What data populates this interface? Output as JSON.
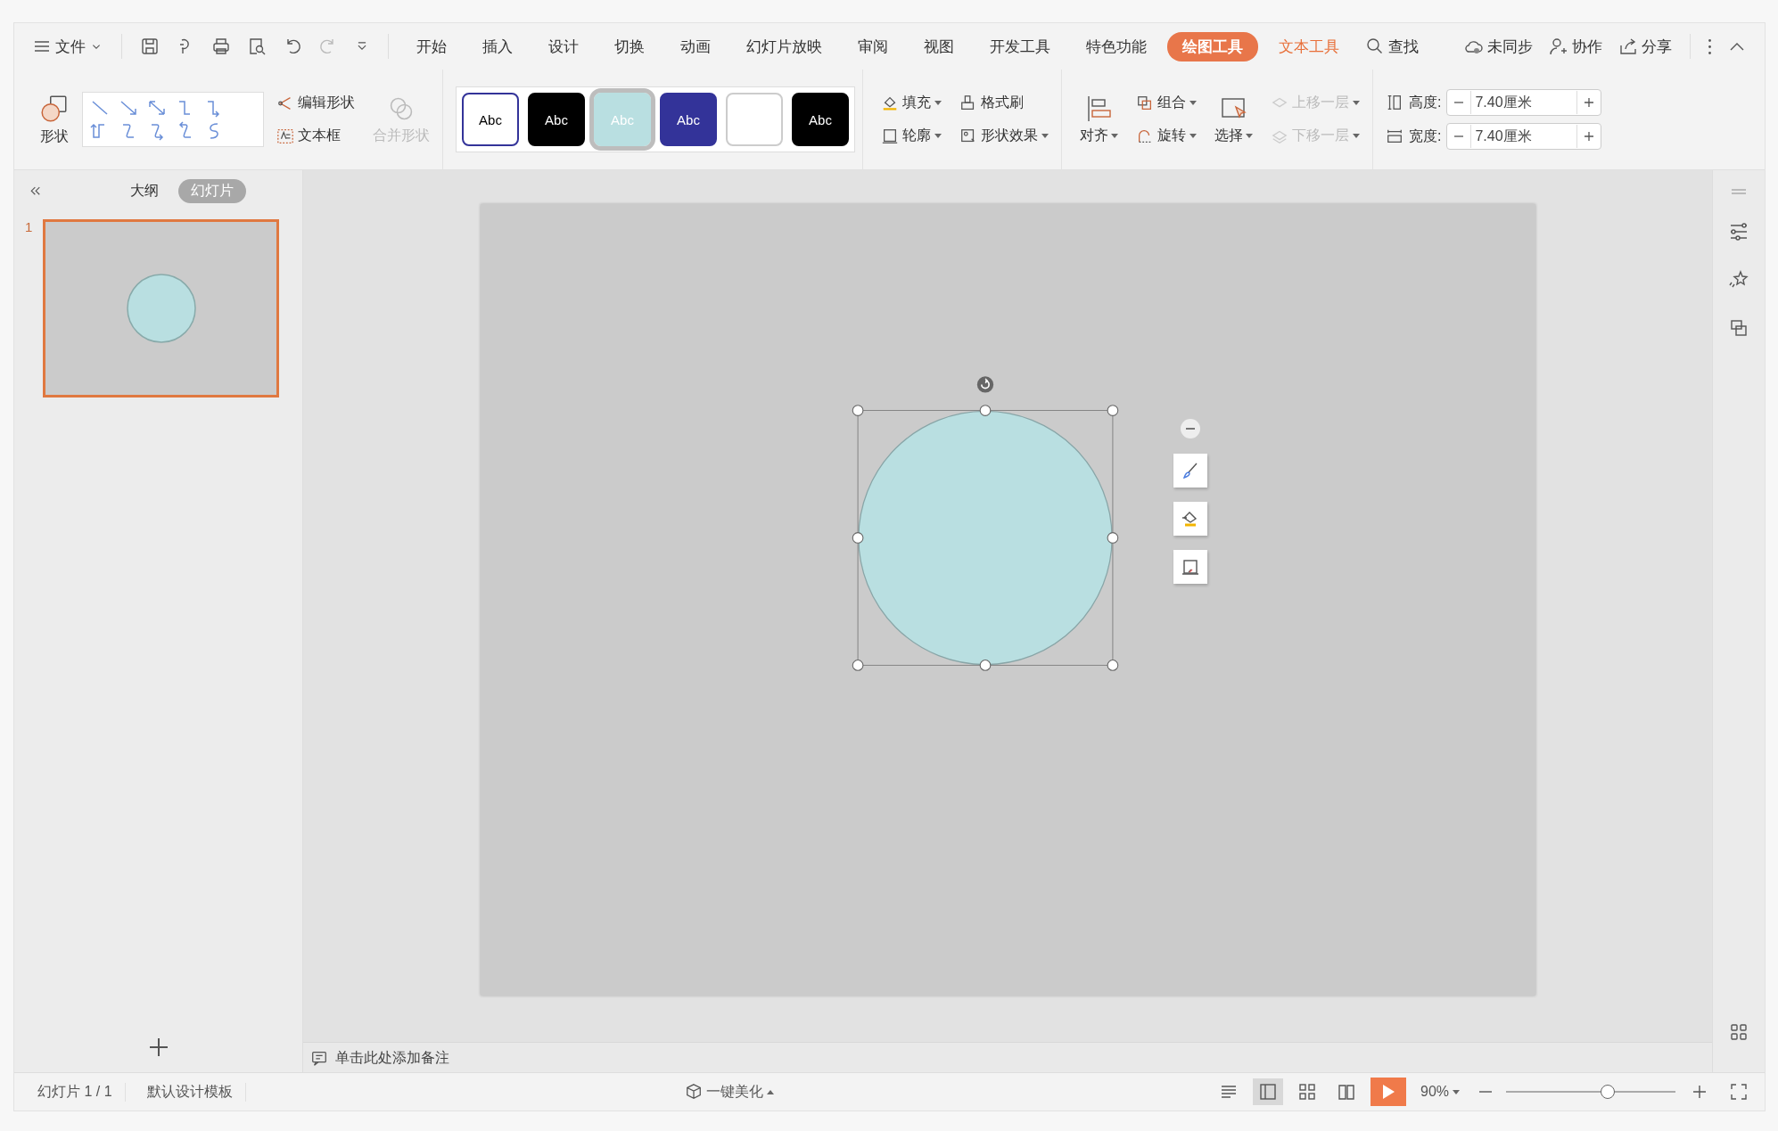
{
  "menu": {
    "label": "文件"
  },
  "tabs": [
    {
      "label": "开始",
      "selected": false,
      "kind": "normal"
    },
    {
      "label": "插入",
      "selected": false,
      "kind": "normal"
    },
    {
      "label": "设计",
      "selected": false,
      "kind": "normal"
    },
    {
      "label": "切换",
      "selected": false,
      "kind": "normal"
    },
    {
      "label": "动画",
      "selected": false,
      "kind": "normal"
    },
    {
      "label": "幻灯片放映",
      "selected": false,
      "kind": "normal"
    },
    {
      "label": "审阅",
      "selected": false,
      "kind": "normal"
    },
    {
      "label": "视图",
      "selected": false,
      "kind": "normal"
    },
    {
      "label": "开发工具",
      "selected": false,
      "kind": "normal"
    },
    {
      "label": "特色功能",
      "selected": false,
      "kind": "normal"
    },
    {
      "label": "绘图工具",
      "selected": true,
      "kind": "context"
    },
    {
      "label": "文本工具",
      "selected": false,
      "kind": "context"
    }
  ],
  "search": {
    "label": "查找"
  },
  "top_actions": [
    "未同步",
    "协作",
    "分享"
  ],
  "ribbon": {
    "shape_button": "形状",
    "edit_shape": "编辑形状",
    "text_box": "文本框",
    "merge_shapes": {
      "label": "合并形状",
      "disabled": true
    },
    "styles": [
      {
        "text": "Abc",
        "color": "#ffffff",
        "kind": "outlined",
        "selected": false
      },
      {
        "text": "Abc",
        "color": "#000000",
        "kind": "plain",
        "selected": false
      },
      {
        "text": "Abc",
        "color": "#b9dfe1",
        "kind": "plain",
        "selected": true
      },
      {
        "text": "Abc",
        "color": "#333399",
        "kind": "plain",
        "selected": false
      },
      {
        "color": "#ffffff",
        "kind": "plain",
        "selected": false
      },
      {
        "text": "Abc",
        "color": "#000000",
        "kind": "plain",
        "selected": false
      }
    ],
    "fill": "填充",
    "outline": "轮廓",
    "format_painter": "格式刷",
    "shape_effects": "形状效果",
    "align": "对齐",
    "group": "组合",
    "rotate": "旋转",
    "select": "选择",
    "bring_forward": {
      "label": "上移一层",
      "disabled": true
    },
    "send_backward": {
      "label": "下移一层",
      "disabled": true
    },
    "height": {
      "label": "高度:",
      "value": "7.40厘米"
    },
    "width": {
      "label": "宽度:",
      "value": "7.40厘米"
    }
  },
  "left_panel": {
    "tabs": [
      {
        "label": "大纲",
        "selected": false
      },
      {
        "label": "幻灯片",
        "selected": true
      }
    ],
    "slides": [
      {
        "number": "1",
        "selected": true
      }
    ]
  },
  "notes": {
    "placeholder": "单击此处添加备注"
  },
  "status_bar": {
    "slide": "幻灯片 1 / 1",
    "template": "默认设计模板",
    "beautify": "一键美化",
    "zoom": "90%",
    "zoom_level": {
      "level": 0.6
    }
  }
}
